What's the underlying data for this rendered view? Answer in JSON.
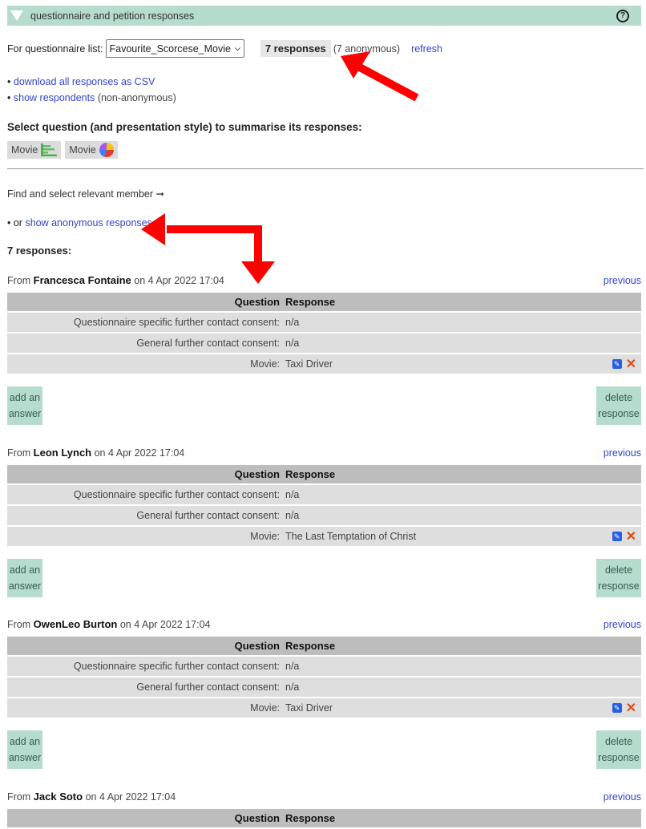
{
  "header": {
    "title": "questionnaire and petition responses",
    "help_icon": "?"
  },
  "questionnaire": {
    "label": "For questionnaire list:",
    "selected": "Favourite_Scorcese_Movie",
    "response_count": "7 responses",
    "anonymous_note": "(7 anonymous)",
    "refresh": "refresh"
  },
  "downloads": {
    "bullet": "•",
    "csv": "download all responses as CSV",
    "show_respondents": "show respondents",
    "non_anon": "(non-anonymous)"
  },
  "summary": {
    "heading": "Select question (and presentation style) to summarise its responses:",
    "pills": [
      {
        "label": "Movie",
        "icon": "bar-chart-icon"
      },
      {
        "label": "Movie",
        "icon": "pie-chart-icon"
      }
    ]
  },
  "member": {
    "find": "Find and select relevant member",
    "arrow": "➞",
    "or": "• or",
    "show_anon": "show anonymous responses"
  },
  "responses_heading": "7 responses:",
  "labels": {
    "from": "From",
    "on": "on",
    "previous": "previous",
    "question_col": "Question",
    "response_col": "Response",
    "add_answer_1": "add an",
    "add_answer_2": "answer",
    "delete_1": "delete",
    "delete_2": "response"
  },
  "responses": [
    {
      "name": "Francesca Fontaine",
      "date": "4 Apr 2022 17:04",
      "rows": [
        {
          "q": "Questionnaire specific further contact consent:",
          "a": "n/a",
          "actions": false
        },
        {
          "q": "General further contact consent:",
          "a": "n/a",
          "actions": false
        },
        {
          "q": "Movie:",
          "a": "Taxi Driver",
          "actions": true
        }
      ]
    },
    {
      "name": "Leon Lynch",
      "date": "4 Apr 2022 17:04",
      "rows": [
        {
          "q": "Questionnaire specific further contact consent:",
          "a": "n/a",
          "actions": false
        },
        {
          "q": "General further contact consent:",
          "a": "n/a",
          "actions": false
        },
        {
          "q": "Movie:",
          "a": "The Last Temptation of Christ",
          "actions": true
        }
      ]
    },
    {
      "name": "OwenLeo Burton",
      "date": "4 Apr 2022 17:04",
      "rows": [
        {
          "q": "Questionnaire specific further contact consent:",
          "a": "n/a",
          "actions": false
        },
        {
          "q": "General further contact consent:",
          "a": "n/a",
          "actions": false
        },
        {
          "q": "Movie:",
          "a": "Taxi Driver",
          "actions": true
        }
      ]
    },
    {
      "name": "Jack Soto",
      "date": "4 Apr 2022 17:04",
      "rows": []
    }
  ],
  "colors": {
    "accent": "#b5dccd",
    "link": "#3344cc",
    "arrow": "#ff0000",
    "delete": "#e04a1a",
    "edit": "#2860e0"
  }
}
